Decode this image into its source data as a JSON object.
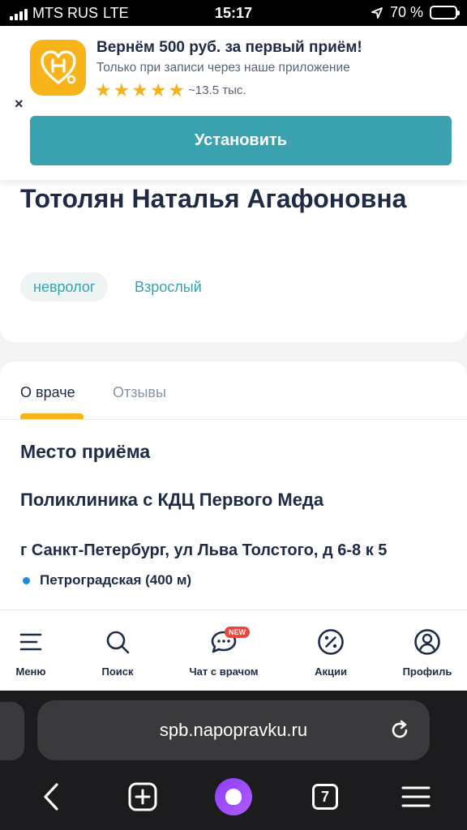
{
  "status_bar": {
    "carrier": "MTS RUS",
    "network": "LTE",
    "time": "15:17",
    "battery": "70 %",
    "battery_level": 0.7
  },
  "app_banner": {
    "title": "Вернём 500 руб. за первый приём!",
    "subtitle": "Только при записи через наше приложение",
    "stars": 5,
    "rating_count": "~13.5 тыс.",
    "install_label": "Установить",
    "close_label": "×",
    "icon": "napopravku-heart-icon",
    "accent_color": "#3aa1ae",
    "icon_color": "#f9b31b"
  },
  "doctor": {
    "name": "Тотолян Наталья Агафоновна",
    "specialty": "невролог",
    "age_group": "Взрослый"
  },
  "tabs": [
    {
      "label": "О враче",
      "active": true
    },
    {
      "label": "Отзывы",
      "active": false
    }
  ],
  "reception": {
    "heading": "Место приёма",
    "clinic_name": "Поликлиника с КДЦ Первого Меда",
    "address": "г Санкт-Петербург, ул Льва Толстого, д 6-8 к 5",
    "metro": "Петроградская (400 м)"
  },
  "bottom_nav": [
    {
      "label": "Меню",
      "icon": "menu-icon"
    },
    {
      "label": "Поиск",
      "icon": "search-icon"
    },
    {
      "label": "Чат с врачом",
      "icon": "chat-icon",
      "badge": "NEW"
    },
    {
      "label": "Акции",
      "icon": "discount-icon"
    },
    {
      "label": "Профиль",
      "icon": "profile-icon"
    }
  ],
  "browser": {
    "url": "spb.napopravku.ru",
    "tab_count": "7"
  }
}
